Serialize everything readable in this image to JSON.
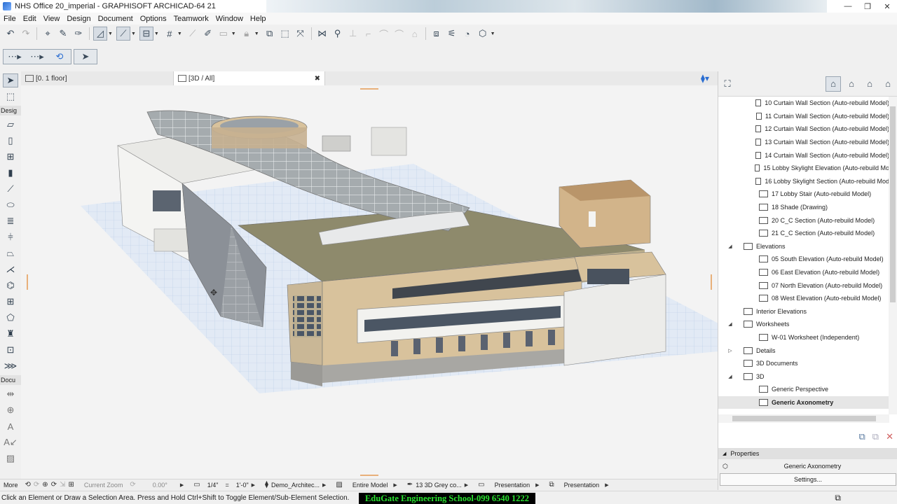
{
  "window": {
    "title": "NHS Office 20_imperial - GRAPHISOFT ARCHICAD-64 21",
    "minimize": "—",
    "restore": "❐",
    "close": "✕"
  },
  "menu": [
    "File",
    "Edit",
    "View",
    "Design",
    "Document",
    "Options",
    "Teamwork",
    "Window",
    "Help"
  ],
  "tabs": {
    "floor_plan": "[0. 1 floor]",
    "view3d": "[3D / All]",
    "close": "✖"
  },
  "toolbox": {
    "design_section": "Desig",
    "document_section": "Docu",
    "more": "More"
  },
  "navigator": {
    "items": [
      {
        "label": "10 Curtain Wall Section (Auto-rebuild Model)",
        "indent": 2,
        "expander": ""
      },
      {
        "label": "11 Curtain Wall Section (Auto-rebuild Model)",
        "indent": 2,
        "expander": ""
      },
      {
        "label": "12 Curtain Wall Section (Auto-rebuild Model)",
        "indent": 2,
        "expander": ""
      },
      {
        "label": "13 Curtain Wall Section (Auto-rebuild Model)",
        "indent": 2,
        "expander": ""
      },
      {
        "label": "14 Curtain Wall Section (Auto-rebuild Model)",
        "indent": 2,
        "expander": ""
      },
      {
        "label": "15 Lobby Skylight Elevation (Auto-rebuild Mo",
        "indent": 2,
        "expander": ""
      },
      {
        "label": "16 Lobby Skylight Section (Auto-rebuild Mod",
        "indent": 2,
        "expander": ""
      },
      {
        "label": "17 Lobby Stair (Auto-rebuild Model)",
        "indent": 2,
        "expander": ""
      },
      {
        "label": "18 Shade (Drawing)",
        "indent": 2,
        "expander": ""
      },
      {
        "label": "20 C_C Section (Auto-rebuild Model)",
        "indent": 2,
        "expander": ""
      },
      {
        "label": "21 C_C Section (Auto-rebuild Model)",
        "indent": 2,
        "expander": ""
      },
      {
        "label": "Elevations",
        "indent": 1,
        "expander": "◢"
      },
      {
        "label": "05 South Elevation (Auto-rebuild Model)",
        "indent": 2,
        "expander": ""
      },
      {
        "label": "06 East Elevation (Auto-rebuild Model)",
        "indent": 2,
        "expander": ""
      },
      {
        "label": "07 North Elevation (Auto-rebuild Model)",
        "indent": 2,
        "expander": ""
      },
      {
        "label": "08 West Elevation (Auto-rebuild Model)",
        "indent": 2,
        "expander": ""
      },
      {
        "label": "Interior Elevations",
        "indent": 1,
        "expander": ""
      },
      {
        "label": "Worksheets",
        "indent": 1,
        "expander": "◢"
      },
      {
        "label": "W-01 Worksheet (Independent)",
        "indent": 2,
        "expander": ""
      },
      {
        "label": "Details",
        "indent": 1,
        "expander": "▷"
      },
      {
        "label": "3D Documents",
        "indent": 1,
        "expander": ""
      },
      {
        "label": "3D",
        "indent": 1,
        "expander": "◢"
      },
      {
        "label": "Generic Perspective",
        "indent": 2,
        "expander": ""
      },
      {
        "label": "Generic Axonometry",
        "indent": 2,
        "expander": "",
        "selected": true
      }
    ]
  },
  "properties": {
    "header": "Properties",
    "name": "Generic Axonometry",
    "settings_button": "Settings..."
  },
  "quick_options": {
    "zoom_label": "Current Zoom",
    "angle": "0.00°",
    "scale": "1/4\"",
    "equals": "=",
    "scale_real": "1'-0\"",
    "layer_combo": "Demo_Architec...",
    "structure": "Entire Model",
    "pen_set": "13 3D Grey co...",
    "model_view": "Presentation",
    "dimension": "Presentation"
  },
  "status": {
    "message": "Click an Element or Draw a Selection Area. Press and Hold Ctrl+Shift to Toggle Element/Sub-Element Selection.",
    "watermark": "EduGate Engineering School-099 6540 1222"
  },
  "colors": {
    "accent": "#2a6dd1",
    "roof": "#8e8a6c",
    "wall": "#d8c29c",
    "grid": "#b7cbe6",
    "watermark_text": "#29e02f"
  }
}
